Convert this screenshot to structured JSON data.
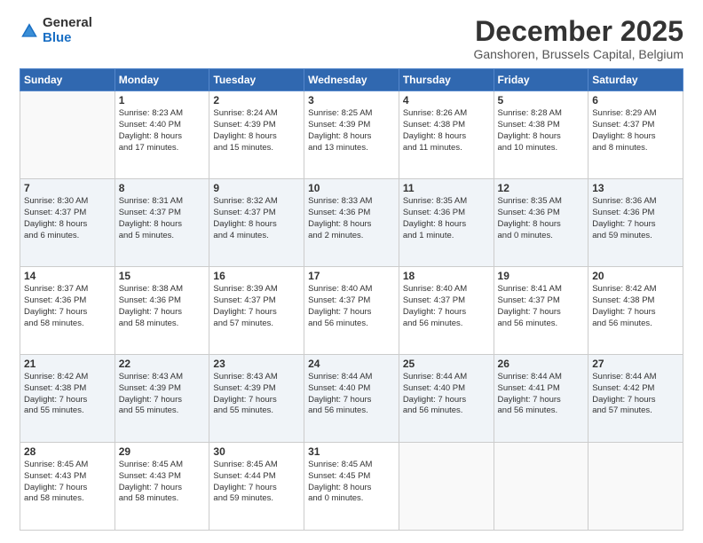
{
  "logo": {
    "general": "General",
    "blue": "Blue"
  },
  "header": {
    "month": "December 2025",
    "location": "Ganshoren, Brussels Capital, Belgium"
  },
  "weekdays": [
    "Sunday",
    "Monday",
    "Tuesday",
    "Wednesday",
    "Thursday",
    "Friday",
    "Saturday"
  ],
  "weeks": [
    [
      {
        "day": "",
        "info": ""
      },
      {
        "day": "1",
        "info": "Sunrise: 8:23 AM\nSunset: 4:40 PM\nDaylight: 8 hours\nand 17 minutes."
      },
      {
        "day": "2",
        "info": "Sunrise: 8:24 AM\nSunset: 4:39 PM\nDaylight: 8 hours\nand 15 minutes."
      },
      {
        "day": "3",
        "info": "Sunrise: 8:25 AM\nSunset: 4:39 PM\nDaylight: 8 hours\nand 13 minutes."
      },
      {
        "day": "4",
        "info": "Sunrise: 8:26 AM\nSunset: 4:38 PM\nDaylight: 8 hours\nand 11 minutes."
      },
      {
        "day": "5",
        "info": "Sunrise: 8:28 AM\nSunset: 4:38 PM\nDaylight: 8 hours\nand 10 minutes."
      },
      {
        "day": "6",
        "info": "Sunrise: 8:29 AM\nSunset: 4:37 PM\nDaylight: 8 hours\nand 8 minutes."
      }
    ],
    [
      {
        "day": "7",
        "info": "Sunrise: 8:30 AM\nSunset: 4:37 PM\nDaylight: 8 hours\nand 6 minutes."
      },
      {
        "day": "8",
        "info": "Sunrise: 8:31 AM\nSunset: 4:37 PM\nDaylight: 8 hours\nand 5 minutes."
      },
      {
        "day": "9",
        "info": "Sunrise: 8:32 AM\nSunset: 4:37 PM\nDaylight: 8 hours\nand 4 minutes."
      },
      {
        "day": "10",
        "info": "Sunrise: 8:33 AM\nSunset: 4:36 PM\nDaylight: 8 hours\nand 2 minutes."
      },
      {
        "day": "11",
        "info": "Sunrise: 8:35 AM\nSunset: 4:36 PM\nDaylight: 8 hours\nand 1 minute."
      },
      {
        "day": "12",
        "info": "Sunrise: 8:35 AM\nSunset: 4:36 PM\nDaylight: 8 hours\nand 0 minutes."
      },
      {
        "day": "13",
        "info": "Sunrise: 8:36 AM\nSunset: 4:36 PM\nDaylight: 7 hours\nand 59 minutes."
      }
    ],
    [
      {
        "day": "14",
        "info": "Sunrise: 8:37 AM\nSunset: 4:36 PM\nDaylight: 7 hours\nand 58 minutes."
      },
      {
        "day": "15",
        "info": "Sunrise: 8:38 AM\nSunset: 4:36 PM\nDaylight: 7 hours\nand 58 minutes."
      },
      {
        "day": "16",
        "info": "Sunrise: 8:39 AM\nSunset: 4:37 PM\nDaylight: 7 hours\nand 57 minutes."
      },
      {
        "day": "17",
        "info": "Sunrise: 8:40 AM\nSunset: 4:37 PM\nDaylight: 7 hours\nand 56 minutes."
      },
      {
        "day": "18",
        "info": "Sunrise: 8:40 AM\nSunset: 4:37 PM\nDaylight: 7 hours\nand 56 minutes."
      },
      {
        "day": "19",
        "info": "Sunrise: 8:41 AM\nSunset: 4:37 PM\nDaylight: 7 hours\nand 56 minutes."
      },
      {
        "day": "20",
        "info": "Sunrise: 8:42 AM\nSunset: 4:38 PM\nDaylight: 7 hours\nand 56 minutes."
      }
    ],
    [
      {
        "day": "21",
        "info": "Sunrise: 8:42 AM\nSunset: 4:38 PM\nDaylight: 7 hours\nand 55 minutes."
      },
      {
        "day": "22",
        "info": "Sunrise: 8:43 AM\nSunset: 4:39 PM\nDaylight: 7 hours\nand 55 minutes."
      },
      {
        "day": "23",
        "info": "Sunrise: 8:43 AM\nSunset: 4:39 PM\nDaylight: 7 hours\nand 55 minutes."
      },
      {
        "day": "24",
        "info": "Sunrise: 8:44 AM\nSunset: 4:40 PM\nDaylight: 7 hours\nand 56 minutes."
      },
      {
        "day": "25",
        "info": "Sunrise: 8:44 AM\nSunset: 4:40 PM\nDaylight: 7 hours\nand 56 minutes."
      },
      {
        "day": "26",
        "info": "Sunrise: 8:44 AM\nSunset: 4:41 PM\nDaylight: 7 hours\nand 56 minutes."
      },
      {
        "day": "27",
        "info": "Sunrise: 8:44 AM\nSunset: 4:42 PM\nDaylight: 7 hours\nand 57 minutes."
      }
    ],
    [
      {
        "day": "28",
        "info": "Sunrise: 8:45 AM\nSunset: 4:43 PM\nDaylight: 7 hours\nand 58 minutes."
      },
      {
        "day": "29",
        "info": "Sunrise: 8:45 AM\nSunset: 4:43 PM\nDaylight: 7 hours\nand 58 minutes."
      },
      {
        "day": "30",
        "info": "Sunrise: 8:45 AM\nSunset: 4:44 PM\nDaylight: 7 hours\nand 59 minutes."
      },
      {
        "day": "31",
        "info": "Sunrise: 8:45 AM\nSunset: 4:45 PM\nDaylight: 8 hours\nand 0 minutes."
      },
      {
        "day": "",
        "info": ""
      },
      {
        "day": "",
        "info": ""
      },
      {
        "day": "",
        "info": ""
      }
    ]
  ]
}
